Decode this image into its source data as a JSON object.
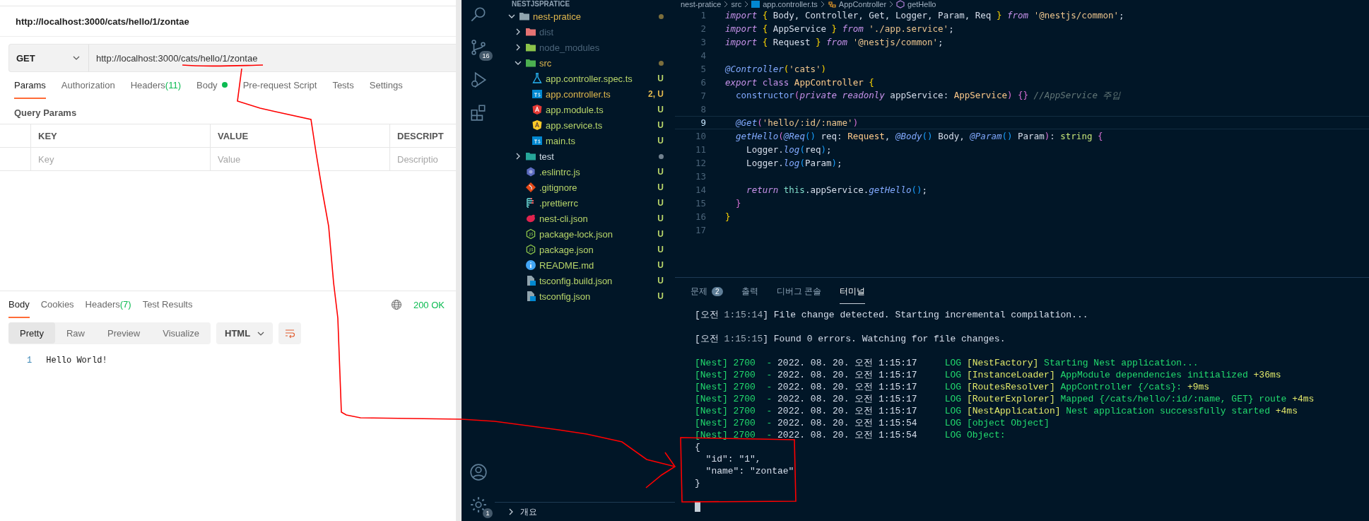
{
  "postman": {
    "request_title": "http://localhost:3000/cats/hello/1/zontae",
    "method": "GET",
    "url": "http://localhost:3000/cats/hello/1/zontae",
    "request_tabs": [
      {
        "label": "Params",
        "dot": false,
        "selected": true
      },
      {
        "label": "Authorization",
        "dot": false,
        "selected": false
      },
      {
        "label": "Headers",
        "count": "(11)",
        "dot": false,
        "selected": false
      },
      {
        "label": "Body",
        "dot": true,
        "selected": false
      },
      {
        "label": "Pre-request Script",
        "dot": false,
        "selected": false
      },
      {
        "label": "Tests",
        "dot": false,
        "selected": false
      },
      {
        "label": "Settings",
        "dot": false,
        "selected": false
      }
    ],
    "query_params_label": "Query Params",
    "params_table": {
      "columns": [
        "KEY",
        "VALUE",
        "DESCRIPT"
      ],
      "placeholders": [
        "Key",
        "Value",
        "Descriptio"
      ]
    },
    "response_tabs": [
      {
        "label": "Body",
        "selected": true
      },
      {
        "label": "Cookies",
        "selected": false
      },
      {
        "label": "Headers",
        "count": "(7)",
        "selected": false
      },
      {
        "label": "Test Results",
        "selected": false
      }
    ],
    "status": "200 OK",
    "view_modes": [
      {
        "label": "Pretty",
        "selected": true
      },
      {
        "label": "Raw",
        "selected": false
      },
      {
        "label": "Preview",
        "selected": false
      },
      {
        "label": "Visualize",
        "selected": false
      }
    ],
    "format": "HTML",
    "body_lines": [
      {
        "num": "1",
        "text": "Hello World!"
      }
    ]
  },
  "activity_bar": {
    "source_control_badge": "16",
    "settings_badge": "1"
  },
  "explorer": {
    "title": "NESTJSPRATICE",
    "tree": [
      {
        "name": "nest-pratice",
        "kind": "folder",
        "color": "#e2b84e",
        "dot": true,
        "expanded": true,
        "children": [
          {
            "name": "dist",
            "kind": "folder",
            "color": "#4b6479",
            "dot": false,
            "expanded": false
          },
          {
            "name": "node_modules",
            "kind": "folder",
            "color": "#4b6479",
            "dot": false,
            "expanded": false
          },
          {
            "name": "src",
            "kind": "folder",
            "color": "#e2b84e",
            "dot": true,
            "expanded": true,
            "children": [
              {
                "name": "app.controller.spec.ts",
                "kind": "file",
                "color": "#b9d66a",
                "badge": "U"
              },
              {
                "name": "app.controller.ts",
                "kind": "file",
                "color": "#e2b84e",
                "badge": "2, U"
              },
              {
                "name": "app.module.ts",
                "kind": "file",
                "color": "#b9d66a",
                "badge": "U"
              },
              {
                "name": "app.service.ts",
                "kind": "file",
                "color": "#b9d66a",
                "badge": "U"
              },
              {
                "name": "main.ts",
                "kind": "file",
                "color": "#b9d66a",
                "badge": "U"
              }
            ]
          },
          {
            "name": "test",
            "kind": "folder",
            "color": "#d0dce6",
            "dot": true,
            "expanded": false
          },
          {
            "name": ".eslintrc.js",
            "kind": "file",
            "color": "#b9d66a",
            "badge": "U"
          },
          {
            "name": ".gitignore",
            "kind": "file",
            "color": "#b9d66a",
            "badge": "U"
          },
          {
            "name": ".prettierrc",
            "kind": "file",
            "color": "#b9d66a",
            "badge": "U"
          },
          {
            "name": "nest-cli.json",
            "kind": "file",
            "color": "#b9d66a",
            "badge": "U"
          },
          {
            "name": "package-lock.json",
            "kind": "file",
            "color": "#b9d66a",
            "badge": "U"
          },
          {
            "name": "package.json",
            "kind": "file",
            "color": "#b9d66a",
            "badge": "U"
          },
          {
            "name": "README.md",
            "kind": "file",
            "color": "#b9d66a",
            "badge": "U"
          },
          {
            "name": "tsconfig.build.json",
            "kind": "file",
            "color": "#b9d66a",
            "badge": "U"
          },
          {
            "name": "tsconfig.json",
            "kind": "file",
            "color": "#b9d66a",
            "badge": "U"
          }
        ]
      }
    ],
    "outline": {
      "label": "개요",
      "expanded": false
    }
  },
  "editor": {
    "breadcrumb": [
      {
        "label": "nest-pratice",
        "kind": "folder"
      },
      {
        "label": "src",
        "kind": "folder"
      },
      {
        "label": "app.controller.ts",
        "kind": "ts"
      },
      {
        "label": "AppController",
        "kind": "class"
      },
      {
        "label": "getHello",
        "kind": "method"
      }
    ],
    "lines": [
      {
        "num": "1",
        "current": false,
        "text": "import { Body, Controller, Get, Logger, Param, Req } from '@nestjs/common';"
      },
      {
        "num": "2",
        "current": false,
        "text": "import { AppService } from './app.service';"
      },
      {
        "num": "3",
        "current": false,
        "text": "import { Request } from '@nestjs/common';"
      },
      {
        "num": "4",
        "current": false
      },
      {
        "num": "5",
        "current": false,
        "text": "@Controller('cats')"
      },
      {
        "num": "6",
        "current": false,
        "text": "export class AppController {"
      },
      {
        "num": "7",
        "current": false,
        "text": "  constructor(private readonly appService: AppService) {} //AppService 주입"
      },
      {
        "num": "8",
        "current": false
      },
      {
        "num": "9",
        "current": true,
        "text": "  @Get('hello/:id/:name')"
      },
      {
        "num": "10",
        "current": false,
        "text": "  getHello(@Req() req: Request, @Body() Body, @Param() Param): string {"
      },
      {
        "num": "11",
        "current": false,
        "text": "    Logger.log(req);"
      },
      {
        "num": "12",
        "current": false,
        "text": "    Logger.log(Param);"
      },
      {
        "num": "13",
        "current": false
      },
      {
        "num": "14",
        "current": false,
        "text": "    return this.appService.getHello();"
      },
      {
        "num": "15",
        "current": false,
        "text": "  }"
      },
      {
        "num": "16",
        "current": false,
        "text": "}"
      },
      {
        "num": "17",
        "current": false
      }
    ]
  },
  "panel": {
    "tabs": [
      {
        "label": "문제",
        "count": "2",
        "selected": false
      },
      {
        "label": "출력",
        "selected": false
      },
      {
        "label": "디버그 콘솔",
        "selected": false
      },
      {
        "label": "터미널",
        "selected": true
      }
    ],
    "terminal_blocks": [
      [
        {
          "kind": "watch",
          "text": "[오전 1:15:14] File change detected. Starting incremental compilation..."
        }
      ],
      [
        {
          "kind": "watch",
          "text": "[오전 1:15:15] Found 0 errors. Watching for file changes."
        }
      ],
      [
        {
          "kind": "nest",
          "text": "[Nest] 2700  - 2022. 08. 20. 오전 1:15:17     LOG [NestFactory] Starting Nest application..."
        },
        {
          "kind": "nest",
          "text": "[Nest] 2700  - 2022. 08. 20. 오전 1:15:17     LOG [InstanceLoader] AppModule dependencies initialized +36ms"
        },
        {
          "kind": "nest",
          "text": "[Nest] 2700  - 2022. 08. 20. 오전 1:15:17     LOG [RoutesResolver] AppController {/cats}: +9ms"
        },
        {
          "kind": "nest",
          "text": "[Nest] 2700  - 2022. 08. 20. 오전 1:15:17     LOG [RouterExplorer] Mapped {/cats/hello/:id/:name, GET} route +4ms"
        },
        {
          "kind": "nest",
          "text": "[Nest] 2700  - 2022. 08. 20. 오전 1:15:17     LOG [NestApplication] Nest application successfully started +4ms"
        },
        {
          "kind": "nest",
          "text": "[Nest] 2700  - 2022. 08. 20. 오전 1:15:54     LOG [object Object]"
        },
        {
          "kind": "nest",
          "text": "[Nest] 2700  - 2022. 08. 20. 오전 1:15:54     LOG Object:"
        },
        {
          "kind": "plain",
          "text": "{"
        },
        {
          "kind": "plain",
          "text": "  \"id\": \"1\","
        },
        {
          "kind": "plain",
          "text": "  \"name\": \"zontae\""
        },
        {
          "kind": "plain",
          "text": "}"
        }
      ]
    ]
  }
}
